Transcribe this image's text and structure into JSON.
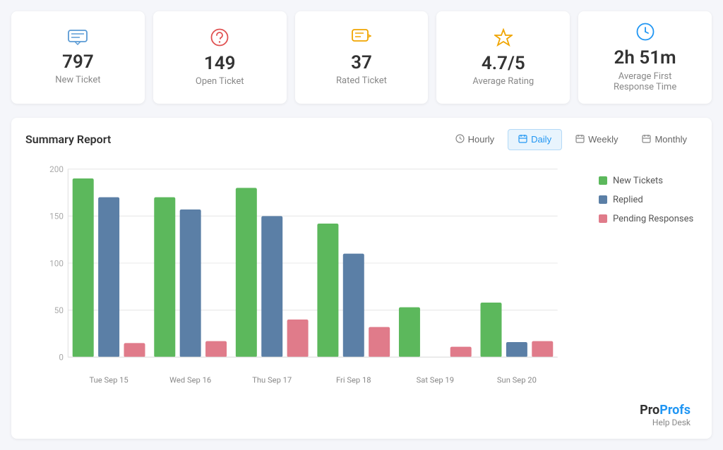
{
  "stats": [
    {
      "id": "new-ticket",
      "value": "797",
      "label": "New Ticket",
      "icon": "💬",
      "icon_color": "#5b9bd5"
    },
    {
      "id": "open-ticket",
      "value": "149",
      "label": "Open Ticket",
      "icon": "😞",
      "icon_color": "#e05252"
    },
    {
      "id": "rated-ticket",
      "value": "37",
      "label": "Rated Ticket",
      "icon": "💬",
      "icon_color": "#f0a500"
    },
    {
      "id": "average-rating",
      "value": "4.7/5",
      "label": "Average Rating",
      "icon": "☆",
      "icon_color": "#f0a500"
    },
    {
      "id": "response-time",
      "value": "2h 51m",
      "label": "Average First\nResponse Time",
      "icon": "🕐",
      "icon_color": "#2196f3"
    }
  ],
  "report": {
    "title": "Summary Report",
    "tabs": [
      {
        "id": "hourly",
        "label": "Hourly",
        "active": false
      },
      {
        "id": "daily",
        "label": "Daily",
        "active": true
      },
      {
        "id": "weekly",
        "label": "Weekly",
        "active": false
      },
      {
        "id": "monthly",
        "label": "Monthly",
        "active": false
      }
    ],
    "legend": [
      {
        "id": "new-tickets",
        "label": "New Tickets",
        "color": "#5cb85c"
      },
      {
        "id": "replied",
        "label": "Replied",
        "color": "#5b7fa6"
      },
      {
        "id": "pending",
        "label": "Pending Responses",
        "color": "#e07b8a"
      }
    ],
    "chart": {
      "yMax": 200,
      "yLabels": [
        0,
        50,
        100,
        150,
        200
      ],
      "bars": [
        {
          "day": "Tue Sep 15",
          "new": 190,
          "replied": 170,
          "pending": 15
        },
        {
          "day": "Wed Sep 16",
          "new": 170,
          "replied": 157,
          "pending": 17
        },
        {
          "day": "Thu Sep 17",
          "new": 180,
          "replied": 150,
          "pending": 40
        },
        {
          "day": "Fri Sep 18",
          "new": 142,
          "replied": 110,
          "pending": 32
        },
        {
          "day": "Sat Sep 19",
          "new": 53,
          "replied": 0,
          "pending": 11
        },
        {
          "day": "Sun Sep 20",
          "new": 58,
          "replied": 16,
          "pending": 17
        }
      ]
    }
  },
  "logo": {
    "pro": "Pro",
    "profs": "Profs",
    "helpdesk": "Help Desk"
  }
}
